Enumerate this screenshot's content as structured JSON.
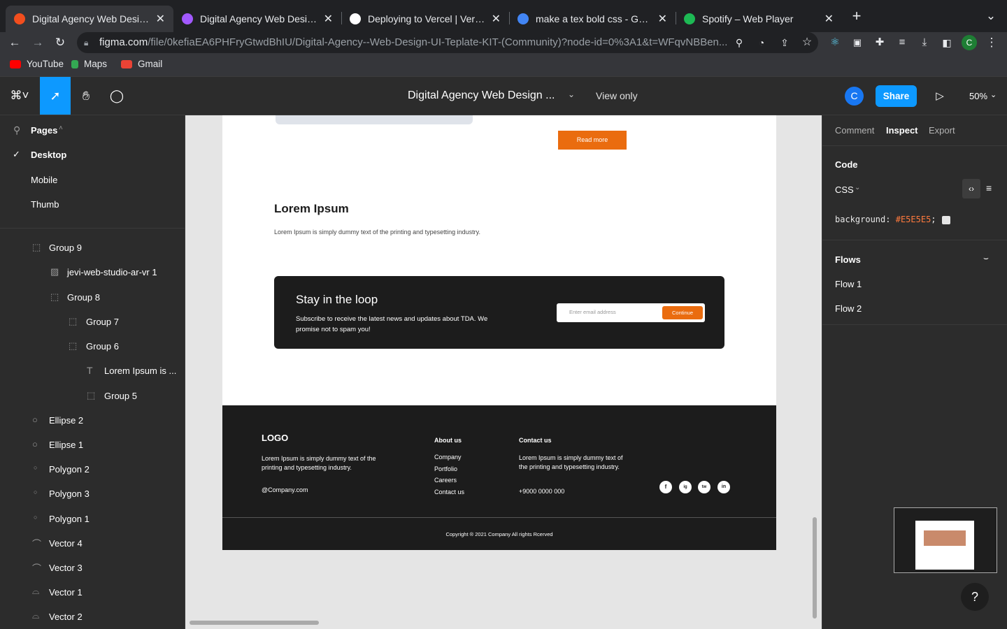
{
  "browser": {
    "tabs": [
      {
        "title": "Digital Agency Web Design UI T",
        "color": "#f24e1e",
        "active": true
      },
      {
        "title": "Digital Agency Web Design UI T",
        "color": "#a259ff",
        "active": false
      },
      {
        "title": "Deploying to Vercel | Vercel Do",
        "color": "#ffffff",
        "active": false
      },
      {
        "title": "make a tex bold css - Google S",
        "color": "#4285f4",
        "active": false
      },
      {
        "title": "Spotify – Web Player",
        "color": "#1db954",
        "active": false
      }
    ],
    "new_tab": "+",
    "url_host": "figma.com",
    "url_path": "/file/0kefiaEA6PHFryGtwdBhIU/Digital-Agency--Web-Design-UI-Teplate-KIT-(Community)?node-id=0%3A1&t=WFqvNBBen...",
    "profile_initial": "C",
    "bookmarks": [
      {
        "label": "YouTube",
        "color": "#ff0000"
      },
      {
        "label": "Maps",
        "color": "#34a853"
      },
      {
        "label": "Gmail",
        "color": "#ea4335"
      }
    ]
  },
  "figma": {
    "file_name": "Digital Agency Web Design ...",
    "view_only": "View only",
    "avatar_initial": "C",
    "share_label": "Share",
    "zoom": "50%"
  },
  "left_panel": {
    "pages_label": "Pages",
    "pages": [
      {
        "label": "Desktop",
        "selected": true
      },
      {
        "label": "Mobile",
        "selected": false
      },
      {
        "label": "Thumb",
        "selected": false
      }
    ],
    "layers": [
      {
        "label": "Group 9",
        "icon": "frame-icon"
      },
      {
        "label": "jevi-web-studio-ar-vr 1",
        "icon": "image-icon"
      },
      {
        "label": "Group 8",
        "icon": "frame-icon"
      },
      {
        "label": "Group 7",
        "icon": "frame-icon"
      },
      {
        "label": "Group 6",
        "icon": "frame-icon"
      },
      {
        "label": "Lorem Ipsum is ...",
        "icon": "text-icon"
      },
      {
        "label": "Group 5",
        "icon": "frame-icon"
      },
      {
        "label": "Ellipse 2",
        "icon": "ellipse-icon"
      },
      {
        "label": "Ellipse 1",
        "icon": "ellipse-icon"
      },
      {
        "label": "Polygon 2",
        "icon": "polygon-icon"
      },
      {
        "label": "Polygon 3",
        "icon": "polygon-icon"
      },
      {
        "label": "Polygon 1",
        "icon": "polygon-icon"
      },
      {
        "label": "Vector 4",
        "icon": "vector-icon"
      },
      {
        "label": "Vector 3",
        "icon": "vector-icon"
      },
      {
        "label": "Vector 1",
        "icon": "vector-icon"
      },
      {
        "label": "Vector 2",
        "icon": "vector-icon"
      }
    ]
  },
  "design": {
    "read_more": "Read more",
    "section_title": "Lorem Ipsum",
    "section_text": "Lorem Ipsum is simply dummy text of the printing and typesetting industry.",
    "newsletter": {
      "title": "Stay in the loop",
      "text": "Subscribe to receive the latest news and updates about TDA. We promise not to spam you!",
      "placeholder": "Enter email address",
      "button": "Continue"
    },
    "footer": {
      "logo": "LOGO",
      "about_text": "Lorem Ipsum is simply dummy text of the printing and typesetting industry.",
      "email": "@Company.com",
      "about_heading": "About us",
      "about_links": [
        "Company",
        "Portfolio",
        "Careers",
        "Contact us"
      ],
      "contact_heading": "Contact us",
      "contact_text": "Lorem Ipsum is simply dummy text of the printing and typesetting industry.",
      "phone": "+9000 0000 000",
      "social": [
        "f",
        "ig",
        "tw",
        "in"
      ],
      "copyright": "Copyright ® 2021 Company All rights Rcerved"
    }
  },
  "right_panel": {
    "tabs": [
      "Comment",
      "Inspect",
      "Export"
    ],
    "active_tab": "Inspect",
    "code_label": "Code",
    "lang": "CSS",
    "css_prop": "background:",
    "css_value": "#E5E5E5",
    "css_end": ";",
    "swatch": "#E5E5E5",
    "flows_label": "Flows",
    "flows": [
      "Flow 1",
      "Flow 2"
    ]
  },
  "help": "?"
}
